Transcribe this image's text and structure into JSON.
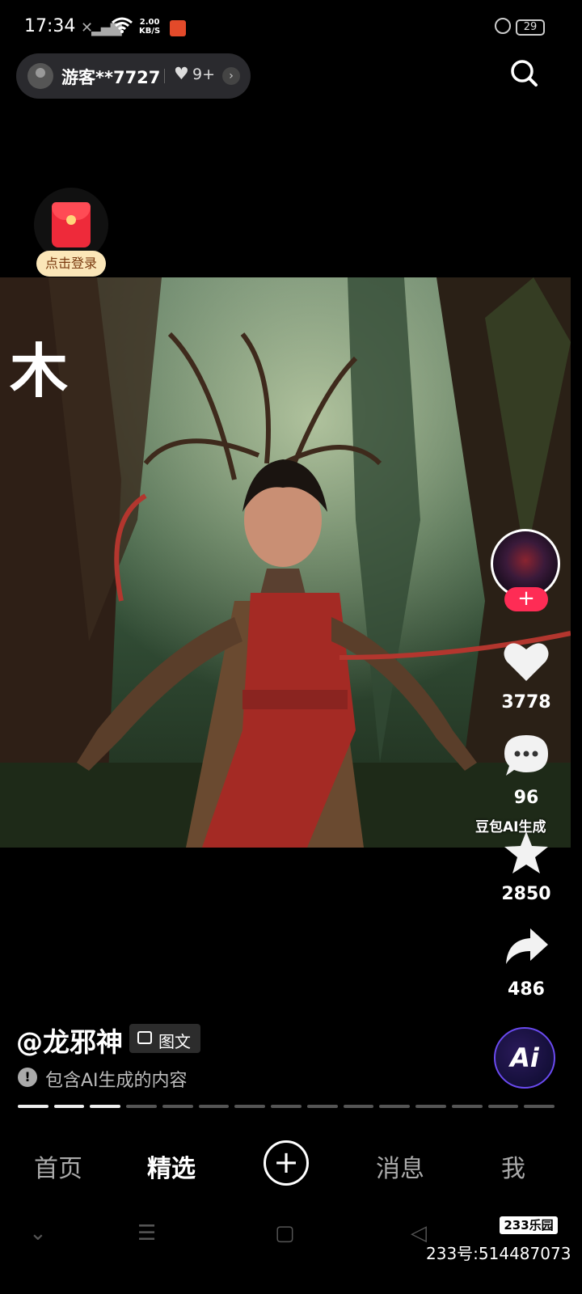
{
  "status_bar": {
    "time": "17:34",
    "net_speed_value": "2.00",
    "net_speed_unit": "KB/S",
    "battery": "29"
  },
  "header": {
    "username": "游客**7727",
    "likes": "9+"
  },
  "promo": {
    "login_label": "点击登录"
  },
  "post": {
    "overlay_char": "木",
    "watermark": "豆包AI生成",
    "handle": "@龙邪神",
    "type_tag": "图文",
    "ai_notice": "包含AI生成的内容",
    "image_count": 15,
    "current_image": 3
  },
  "actions": {
    "likes": "3778",
    "comments": "96",
    "favorites": "2850",
    "shares": "486",
    "ai_button_label": "Ai"
  },
  "tabs": [
    {
      "label": "首页",
      "active": false
    },
    {
      "label": "精选",
      "active": true
    },
    {
      "label": "消息",
      "active": false
    },
    {
      "label": "我",
      "active": false
    }
  ],
  "overlay_brand": {
    "logo": "233乐园",
    "account": "233号:514487073"
  },
  "colors": {
    "follow": "#fe2c55",
    "login_pill": "#fbe6b8",
    "ai_ring": "#6a4af0"
  }
}
